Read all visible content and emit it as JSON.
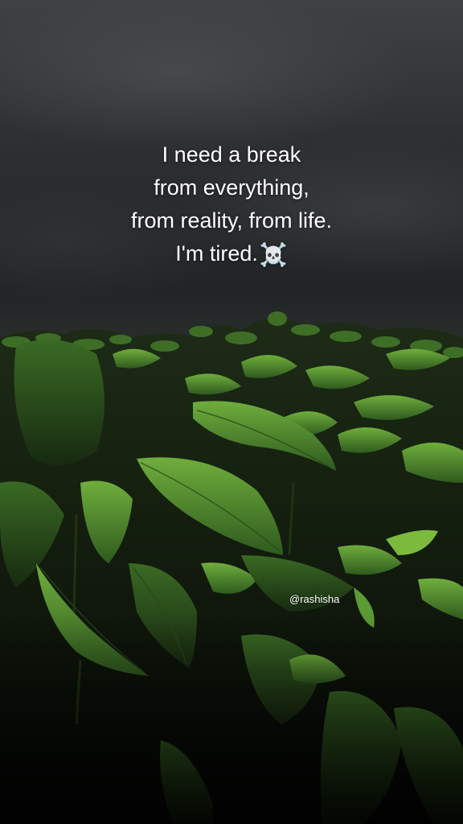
{
  "caption": {
    "lines": [
      "I need a break",
      "from everything,",
      "from reality, from life.",
      "I'm tired."
    ],
    "emoji": "☠️"
  },
  "watermark": {
    "handle": "@rashisha"
  },
  "scene": {
    "sky_color": "#2e3033",
    "leaf_color": "#3f7a2a",
    "leaf_highlight": "#6fae3c"
  }
}
